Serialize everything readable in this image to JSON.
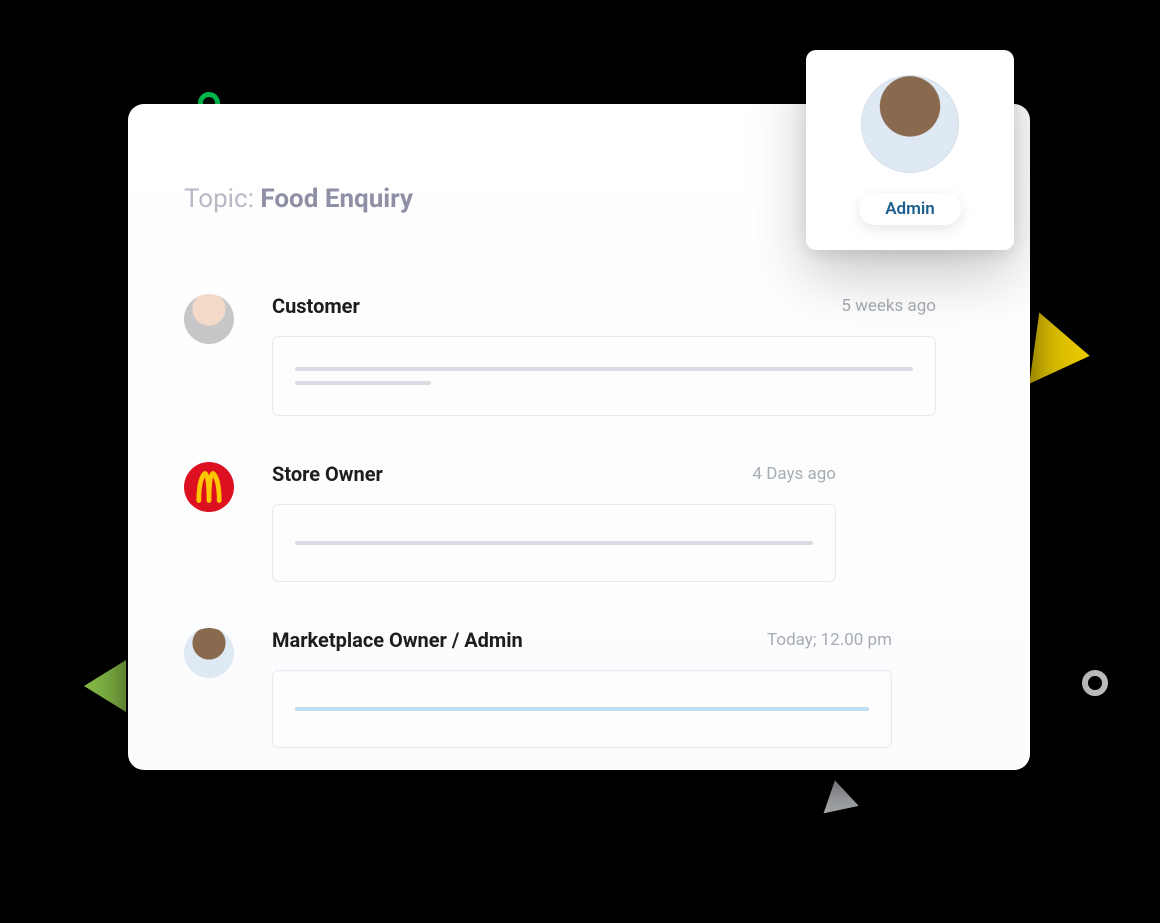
{
  "topic": {
    "label": "Topic:",
    "value": "Food Enquiry"
  },
  "admin": {
    "badge": "Admin"
  },
  "thread": [
    {
      "role": "Customer",
      "time": "5 weeks ago"
    },
    {
      "role": "Store Owner",
      "time": "4 Days ago"
    },
    {
      "role": "Marketplace Owner / Admin",
      "time": "Today;  12.00 pm"
    }
  ]
}
